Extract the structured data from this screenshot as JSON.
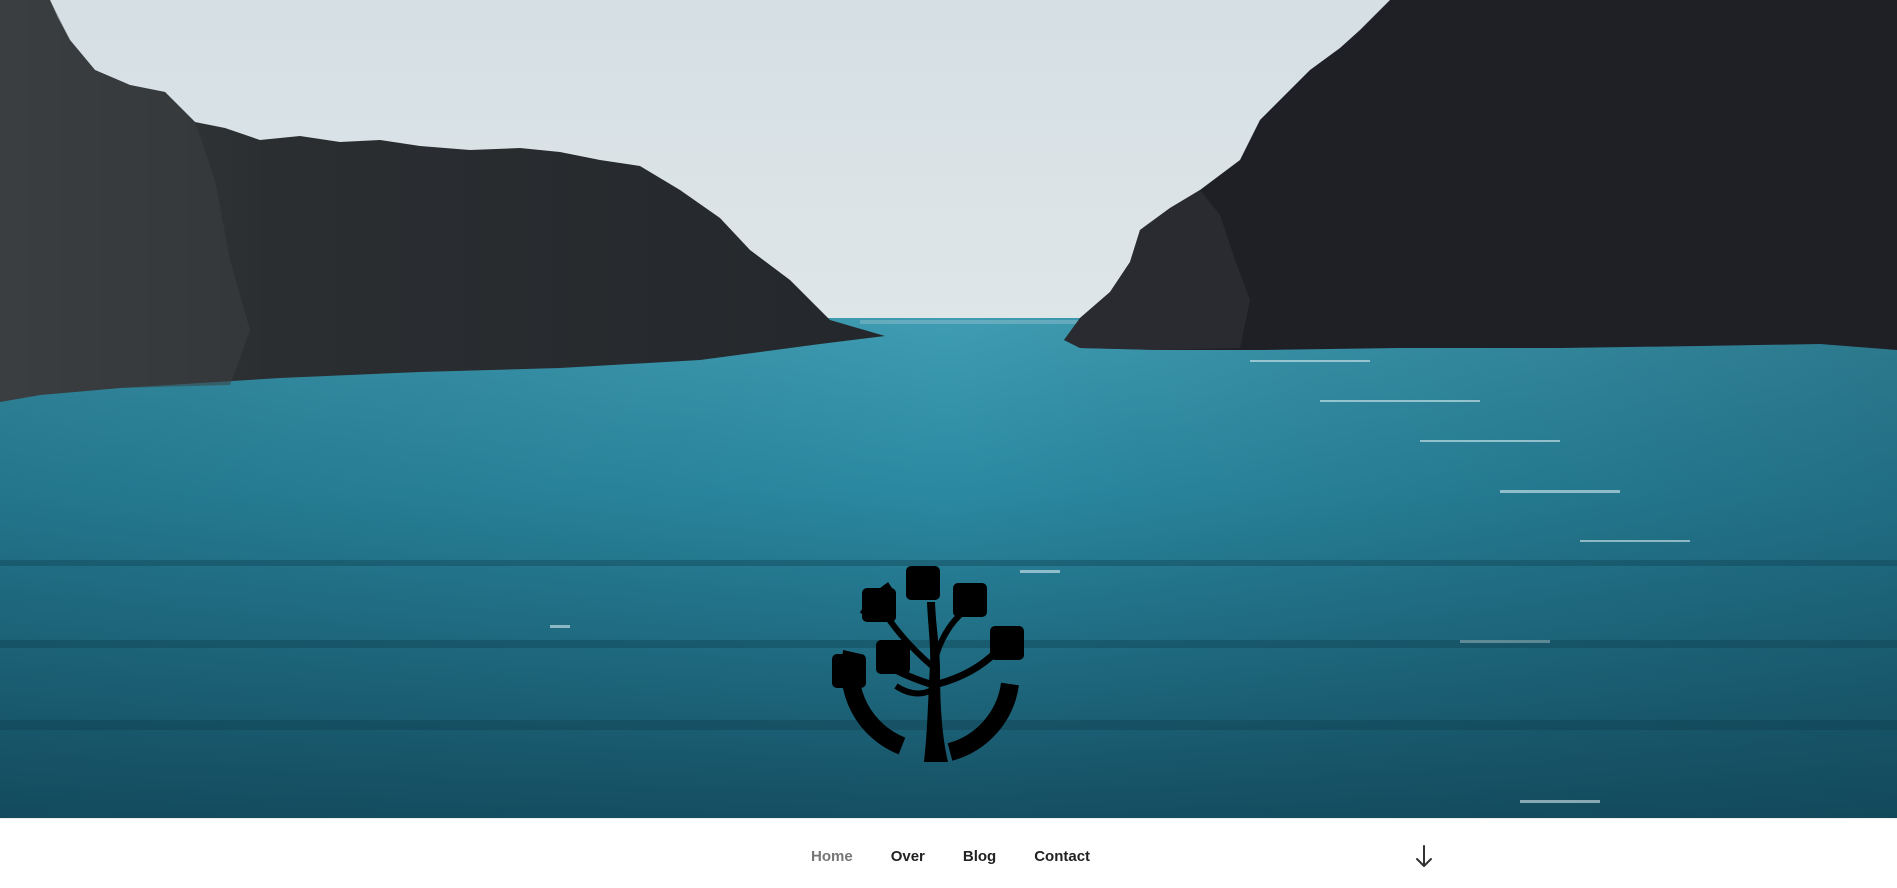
{
  "colors": {
    "sky": "#e6ebee",
    "cliff": "#22242a",
    "sea_light": "#2f90a6",
    "sea_dark": "#144d61",
    "nav_text": "#222222",
    "nav_current": "#767676"
  },
  "hero": {
    "image": "sea-cove-between-cliffs",
    "logo_icon": "tree-logo-icon"
  },
  "navigation": {
    "items": [
      {
        "label": "Home",
        "current": true
      },
      {
        "label": "Over",
        "current": false
      },
      {
        "label": "Blog",
        "current": false
      },
      {
        "label": "Contact",
        "current": false
      }
    ],
    "scroll_icon": "arrow-down-icon"
  }
}
